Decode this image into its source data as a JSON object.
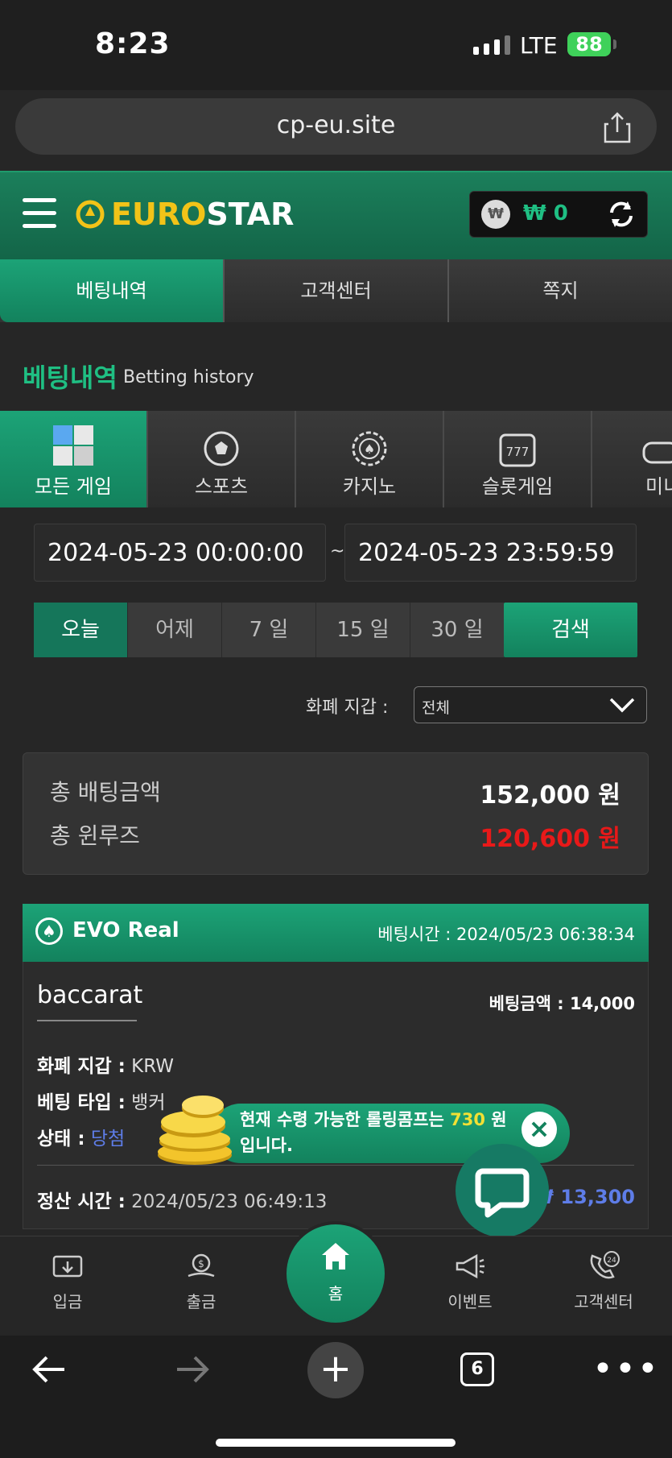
{
  "status_bar": {
    "time": "8:23",
    "network": "LTE",
    "battery": "88"
  },
  "browser": {
    "url": "cp-eu.site",
    "tab_count": "6"
  },
  "brand": {
    "logo_prefix": "EURO",
    "logo_suffix": "STAR"
  },
  "wallet": {
    "currency_symbol": "₩",
    "balance": "₩ 0"
  },
  "tabs": [
    {
      "label": "베팅내역",
      "active": true
    },
    {
      "label": "고객센터",
      "active": false
    },
    {
      "label": "쪽지",
      "active": false
    }
  ],
  "page": {
    "title": "베팅내역",
    "subtitle": "Betting history"
  },
  "categories": [
    {
      "label": "모든 게임",
      "icon": "all-games-icon",
      "active": true
    },
    {
      "label": "스포츠",
      "icon": "soccer-ball-icon",
      "active": false
    },
    {
      "label": "카지노",
      "icon": "casino-chip-icon",
      "active": false
    },
    {
      "label": "슬롯게임",
      "icon": "slot-machine-icon",
      "active": false
    },
    {
      "label": "미니",
      "icon": "gamepad-icon",
      "active": false
    }
  ],
  "filters": {
    "date_from": "2024-05-23 00:00:00",
    "date_sep": "~",
    "date_to": "2024-05-23 23:59:59",
    "quick": [
      "오늘",
      "어제",
      "7 일",
      "15 일",
      "30 일"
    ],
    "quick_active": "오늘",
    "search_label": "검색",
    "wallet_label": "화폐 지갑 :",
    "wallet_value": "전체"
  },
  "summary": {
    "total_bet_label": "총 배팅금액",
    "total_bet_value": "152,000 원",
    "total_winloss_label": "총 윈루즈",
    "total_winloss_value": "120,600 원"
  },
  "bet": {
    "provider": "EVO Real",
    "bet_time": "베팅시간 : 2024/05/23 06:38:34",
    "game": "baccarat",
    "bet_amount": "베팅금액 : 14,000",
    "wallet_label": "화폐 지갑 :",
    "wallet_value": "KRW",
    "type_label": "베팅 타입 :",
    "type_value": "뱅커",
    "status_label": "상태 :",
    "status_value": "당첨",
    "settle_label": "정산 시간 :",
    "settle_value": "2024/05/23 06:49:13",
    "payout": "₩ 13,300"
  },
  "toast": {
    "text_before": "현재 수령 가능한 롤링콤프는",
    "amount": "730",
    "text_after": "원 입니다."
  },
  "bottom_nav": [
    {
      "label": "입금",
      "icon": "deposit-icon"
    },
    {
      "label": "출금",
      "icon": "withdraw-icon"
    },
    {
      "label": "홈",
      "icon": "home-icon"
    },
    {
      "label": "이벤트",
      "icon": "megaphone-icon"
    },
    {
      "label": "고객센터",
      "icon": "support-24-icon"
    }
  ],
  "colors": {
    "accent": "#1ca377",
    "negative": "#e81919",
    "link": "#5e7de8",
    "highlight": "#f2e034"
  }
}
